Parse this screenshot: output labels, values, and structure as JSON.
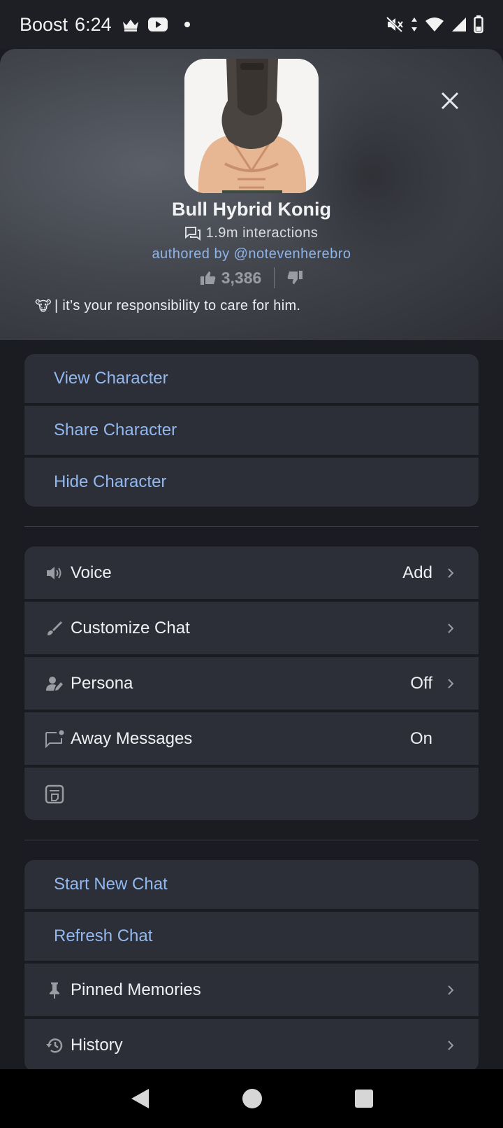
{
  "status_bar": {
    "carrier": "Boost",
    "time": "6:24",
    "left_icons": [
      "crown-icon",
      "youtube-icon",
      "dot-icon"
    ],
    "right_icons": [
      "mute-icon",
      "data-arrows-icon",
      "wifi-icon",
      "signal-icon",
      "battery-icon"
    ]
  },
  "character": {
    "name": "Bull Hybrid Konig",
    "interactions": "1.9m interactions",
    "author": "authored by @notevenherebro",
    "likes": "3,386",
    "tagline_emoji": "🐮",
    "tagline": "| it’s your responsibility to care for him."
  },
  "actions": [
    {
      "label": "View Character"
    },
    {
      "label": "Share Character"
    },
    {
      "label": "Hide Character"
    }
  ],
  "settings": [
    {
      "label": "Voice",
      "value": "Add",
      "icon": "speaker-icon",
      "chevron": true
    },
    {
      "label": "Customize Chat",
      "value": "",
      "icon": "brush-icon",
      "chevron": true
    },
    {
      "label": "Persona",
      "value": "Off",
      "icon": "persona-icon",
      "chevron": true
    },
    {
      "label": "Away Messages",
      "value": "On",
      "icon": "message-notify-icon",
      "chevron": false
    },
    {
      "label": "",
      "value": "",
      "icon": "sticker-icon",
      "chevron": false
    }
  ],
  "chat_actions": [
    {
      "label": "Start New Chat"
    },
    {
      "label": "Refresh Chat"
    }
  ],
  "chat_settings": [
    {
      "label": "Pinned Memories",
      "icon": "pin-icon",
      "chevron": true
    },
    {
      "label": "History",
      "icon": "history-icon",
      "chevron": true
    }
  ],
  "colors": {
    "background": "#1b1c21",
    "row": "#2c2f37",
    "accent_link": "#92b8ef",
    "author_link": "#8fb4e8"
  }
}
